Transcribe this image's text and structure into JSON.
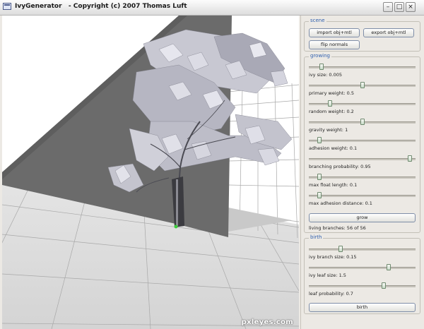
{
  "window": {
    "title": "IvyGenerator   - Copyright (c) 2007 Thomas Luft",
    "min_glyph": "–",
    "max_glyph": "□",
    "close_glyph": "×"
  },
  "scene": {
    "title": "scene",
    "import_label": "import obj+mtl",
    "export_label": "export obj+mtl",
    "flip_label": "flip normals"
  },
  "growing": {
    "title": "growing",
    "sliders": [
      {
        "label": "ivy size: 0.005",
        "value": 0.12
      },
      {
        "label": "primary weight: 0.5",
        "value": 0.5
      },
      {
        "label": "random weight: 0.2",
        "value": 0.2
      },
      {
        "label": "gravity weight: 1",
        "value": 0.5
      },
      {
        "label": "adhesion weight: 0.1",
        "value": 0.1
      },
      {
        "label": "branching probability: 0.95",
        "value": 0.95
      },
      {
        "label": "max float length: 0.1",
        "value": 0.1
      },
      {
        "label": "max adhesion distance: 0.1",
        "value": 0.1
      }
    ],
    "grow_label": "grow",
    "status": "living branches: 56 of 56"
  },
  "birth": {
    "title": "birth",
    "sliders": [
      {
        "label": "ivy branch size: 0.15",
        "value": 0.3
      },
      {
        "label": "ivy leaf size: 1.5",
        "value": 0.75
      },
      {
        "label": "leaf probability: 0.7",
        "value": 0.7
      }
    ],
    "birth_label": "birth"
  },
  "watermark": "pxleyes.com",
  "colors": {
    "wall": "#6b6b6b",
    "floor": "#d8d8d8",
    "grid": "#9c9c9c",
    "leaf": "#b8b8c4",
    "accent": "#2f5fae"
  }
}
